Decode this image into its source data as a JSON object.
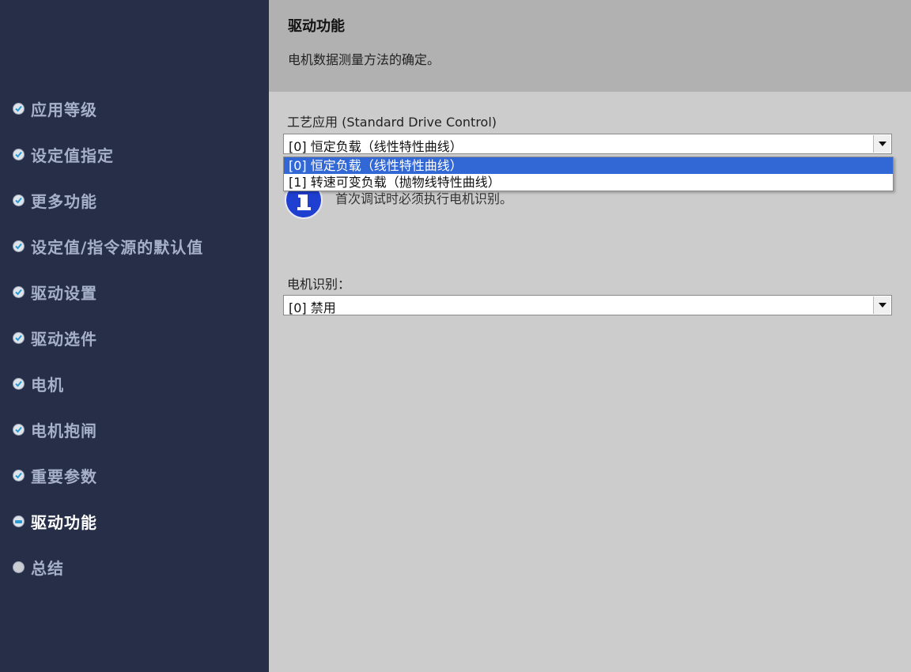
{
  "sidebar": {
    "items": [
      {
        "label": "应用等级",
        "state": "done"
      },
      {
        "label": "设定值指定",
        "state": "done"
      },
      {
        "label": "更多功能",
        "state": "done"
      },
      {
        "label": "设定值/指令源的默认值",
        "state": "done"
      },
      {
        "label": "驱动设置",
        "state": "done"
      },
      {
        "label": "驱动选件",
        "state": "done"
      },
      {
        "label": "电机",
        "state": "done"
      },
      {
        "label": "电机抱闸",
        "state": "done"
      },
      {
        "label": "重要参数",
        "state": "done"
      },
      {
        "label": "驱动功能",
        "state": "current"
      },
      {
        "label": "总结",
        "state": "pending"
      }
    ]
  },
  "header": {
    "title": "驱动功能",
    "subtitle": "电机数据测量方法的确定。"
  },
  "main": {
    "tech_app_label": "工艺应用 (Standard Drive Control)",
    "tech_app_value": "[0] 恒定负载（线性特性曲线）",
    "tech_app_options": [
      "[0] 恒定负载（线性特性曲线）",
      "[1] 转速可变负载（抛物线特性曲线）"
    ],
    "info_text": "首次调试时必须执行电机识别。",
    "motor_id_label": "电机识别：",
    "motor_id_value": "[0] 禁用"
  },
  "colors": {
    "sidebar_bg": "#272f48",
    "header_bg": "#b1b1b1",
    "content_bg": "#cccccc",
    "selection": "#3168d5",
    "info_icon": "#1f3fd0"
  }
}
